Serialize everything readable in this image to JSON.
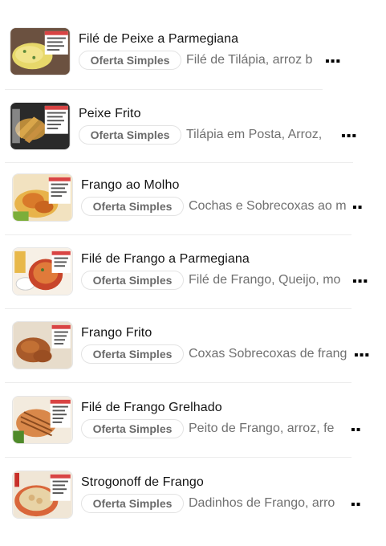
{
  "menu": {
    "items": [
      {
        "title": "Filé de Peixe a Parmegiana",
        "badge": "Oferta Simples",
        "description": "Filé de Tilápia, arroz b",
        "more": "▪▪▪",
        "thumb_icon": "fish-parmigiana-photo"
      },
      {
        "title": "Peixe Frito",
        "badge": "Oferta Simples",
        "description": "Tilápia em Posta, Arroz,",
        "more": "▪▪▪",
        "thumb_icon": "fried-fish-photo"
      },
      {
        "title": "Frango ao Molho",
        "badge": "Oferta Simples",
        "description": "Cochas e Sobrecoxas ao m",
        "more": "▪▪",
        "thumb_icon": "chicken-sauce-photo"
      },
      {
        "title": "Filé de Frango a Parmegiana",
        "badge": "Oferta Simples",
        "description": "Filé de Frango, Queijo, mo",
        "more": "▪▪▪",
        "thumb_icon": "chicken-parmigiana-photo"
      },
      {
        "title": "Frango Frito",
        "badge": "Oferta Simples",
        "description": "Coxas Sobrecoxas de frang",
        "more": "▪▪▪",
        "thumb_icon": "fried-chicken-photo"
      },
      {
        "title": "Filé de Frango Grelhado",
        "badge": "Oferta Simples",
        "description": "Peito de Frango, arroz, fe",
        "more": "▪▪",
        "thumb_icon": "grilled-chicken-photo"
      },
      {
        "title": "Strogonoff de Frango",
        "badge": "Oferta Simples",
        "description": "Dadinhos de Frango, arro",
        "more": "▪▪",
        "thumb_icon": "stroganoff-photo"
      }
    ]
  },
  "colors": {
    "title": "#141414",
    "description": "#707070",
    "badge_text": "#6a6a6a",
    "badge_border": "#e3e3e3",
    "divider": "#ececec"
  }
}
